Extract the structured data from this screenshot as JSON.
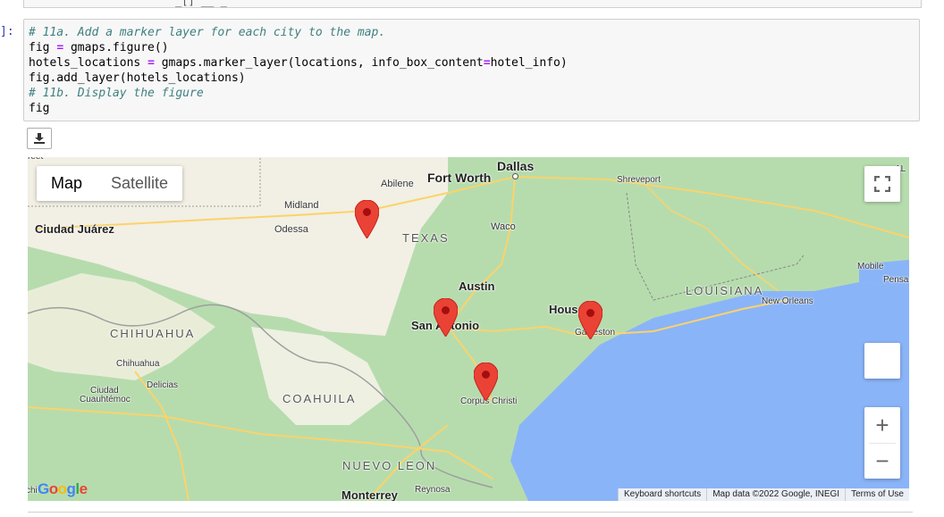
{
  "prev_cell_fragment": "_[]  __  _",
  "cell": {
    "prompt": "]:",
    "lines": [
      {
        "type": "comment",
        "text": "# 11a. Add a marker layer for each city to the map."
      },
      {
        "type": "code",
        "parts": [
          "fig ",
          "=",
          " gmaps.figure()"
        ]
      },
      {
        "type": "code",
        "parts": [
          "hotels_locations ",
          "=",
          " gmaps.marker_layer(locations, info_box_content",
          "=",
          "hotel_info)"
        ]
      },
      {
        "type": "code",
        "parts": [
          "fig.add_layer(hotels_locations)"
        ]
      },
      {
        "type": "comment",
        "text": "# 11b. Display the figure"
      },
      {
        "type": "code",
        "parts": [
          "fig"
        ]
      }
    ]
  },
  "download_button": {
    "icon": "download-icon"
  },
  "map": {
    "map_type": {
      "map_label": "Map",
      "satellite_label": "Satellite",
      "selected": "Map"
    },
    "labels": {
      "dallas": "Dallas",
      "fort_worth": "Fort Worth",
      "abilene": "Abilene",
      "midland": "Midland",
      "odessa": "Odessa",
      "ciudad_juarez": "Ciudad Juárez",
      "texas": "TEXAS",
      "waco": "Waco",
      "shreveport": "Shreveport",
      "austin": "Austin",
      "louisiana": "LOUISIANA",
      "mobile": "Mobile",
      "pensacola": "Pensa",
      "new_orleans": "New Orleans",
      "houston": "Hous",
      "galveston": "Galveston",
      "san_antonio": "San Antonio",
      "chihuahua_state": "CHIHUAHUA",
      "chihuahua": "Chihuahua",
      "delicias": "Delicias",
      "ciudad_cuauhtemoc_1": "Ciudad",
      "ciudad_cuauhtemoc_2": "Cuauhtémoc",
      "coahuila": "COAHUILA",
      "corpus_christi": "Corpus Christi",
      "nuevo_leon": "NUEVO LEON",
      "reynosa": "Reynosa",
      "monterrey": "Monterrey",
      "edge_left": "chi",
      "edge_top": "reet",
      "edge_right": "AL"
    },
    "google_logo": "Google",
    "footer": {
      "shortcuts": "Keyboard shortcuts",
      "map_data": "Map data ©2022 Google, INEGI",
      "terms": "Terms of Use"
    },
    "colors": {
      "land": "#b6dcae",
      "desert": "#f2efe4",
      "water": "#8ab4f8",
      "road": "#fbd36b",
      "marker": "#ea4335",
      "marker_dark": "#a50e0e"
    },
    "controls": {
      "fullscreen_icon": "fullscreen-icon",
      "zoom_in": "+",
      "zoom_out": "−"
    }
  }
}
